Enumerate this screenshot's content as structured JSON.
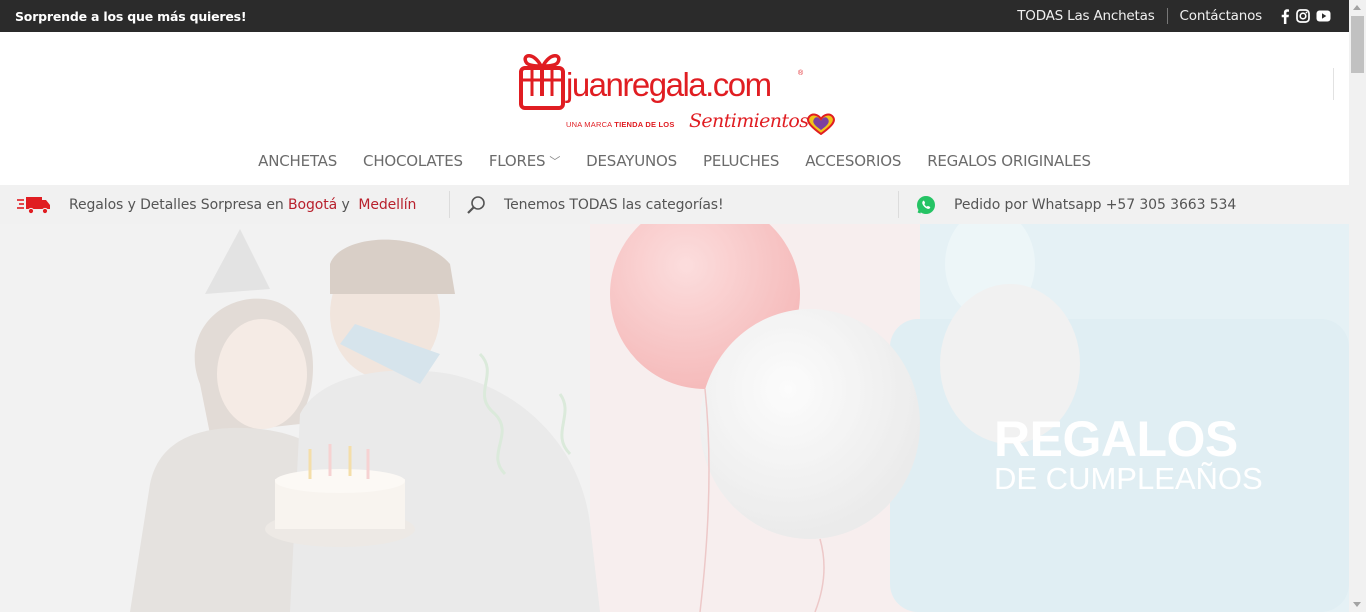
{
  "topbar": {
    "promo": "Sorprende a los que más quieres!",
    "links": [
      "TODAS Las Anchetas",
      "Contáctanos"
    ],
    "social": [
      "facebook-icon",
      "instagram-icon",
      "youtube-icon"
    ]
  },
  "logo": {
    "brand": "juanregala.com",
    "registered": "®",
    "tagline_prefix": "UNA MARCA",
    "tagline_bold": "TIENDA DE LOS",
    "tagline_script": "Sentimientos"
  },
  "nav": {
    "items": [
      "ANCHETAS",
      "CHOCOLATES",
      "FLORES",
      "DESAYUNOS",
      "PELUCHES",
      "ACCESORIOS",
      "REGALOS ORIGINALES"
    ]
  },
  "infobar": {
    "delivery_text": "Regalos y Detalles Sorpresa en",
    "city1": "Bogotá",
    "connector": "y",
    "city2": "Medellín",
    "categories_text": "Tenemos TODAS las categorías!",
    "whatsapp_text": "Pedido por Whatsapp +57 305 3663 534"
  },
  "hero": {
    "title": "REGALOS",
    "subtitle": "DE CUMPLEAÑOS"
  },
  "colors": {
    "brand_red": "#e01d22",
    "topbar_bg": "#2b2b2b",
    "city_link": "#b8212d",
    "hero_panel": "#dcedf2"
  }
}
